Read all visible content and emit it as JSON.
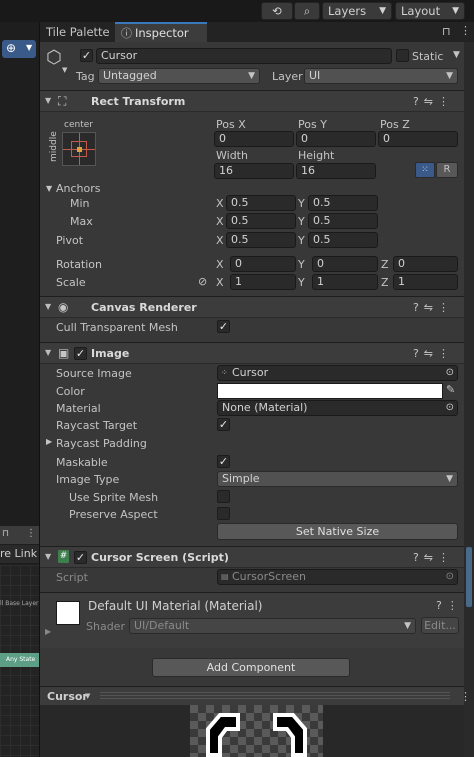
{
  "toolbar": {
    "layers": "Layers",
    "layout": "Layout",
    "history_icon": "history-icon",
    "search_icon": "search-icon"
  },
  "tabs": {
    "tile_palette": "Tile Palette",
    "inspector": "Inspector"
  },
  "object": {
    "name": "Cursor",
    "active": true,
    "static_label": "Static",
    "tag_label": "Tag",
    "tag": "Untagged",
    "layer_label": "Layer",
    "layer": "UI"
  },
  "rect_transform": {
    "title": "Rect Transform",
    "anchor_h": "center",
    "anchor_v": "middle",
    "pos_x_label": "Pos X",
    "pos_y_label": "Pos Y",
    "pos_z_label": "Pos Z",
    "pos_x": "0",
    "pos_y": "0",
    "pos_z": "0",
    "width_label": "Width",
    "height_label": "Height",
    "width": "16",
    "height": "16",
    "r_button": "R",
    "anchors_label": "Anchors",
    "min_label": "Min",
    "max_label": "Max",
    "min_x": "0.5",
    "min_y": "0.5",
    "max_x": "0.5",
    "max_y": "0.5",
    "pivot_label": "Pivot",
    "pivot_x": "0.5",
    "pivot_y": "0.5",
    "rotation_label": "Rotation",
    "rot_x": "0",
    "rot_y": "0",
    "rot_z": "0",
    "scale_label": "Scale",
    "scale_x": "1",
    "scale_y": "1",
    "scale_z": "1",
    "x": "X",
    "y": "Y",
    "z": "Z"
  },
  "canvas_renderer": {
    "title": "Canvas Renderer",
    "cull_label": "Cull Transparent Mesh",
    "cull": true
  },
  "image": {
    "title": "Image",
    "source_label": "Source Image",
    "source": "Cursor",
    "color_label": "Color",
    "color": "#ffffff",
    "material_label": "Material",
    "material": "None (Material)",
    "raycast_target_label": "Raycast Target",
    "raycast_target": true,
    "raycast_padding_label": "Raycast Padding",
    "maskable_label": "Maskable",
    "maskable": true,
    "image_type_label": "Image Type",
    "image_type": "Simple",
    "use_sprite_mesh_label": "Use Sprite Mesh",
    "preserve_aspect_label": "Preserve Aspect",
    "native_size_button": "Set Native Size"
  },
  "script": {
    "title": "Cursor Screen (Script)",
    "script_label": "Script",
    "script_value": "CursorScreen"
  },
  "material": {
    "title": "Default UI Material (Material)",
    "shader_label": "Shader",
    "shader": "UI/Default",
    "edit_button": "Edit..."
  },
  "add_component": "Add Component",
  "preview": {
    "title": "Cursor"
  },
  "left_panel": {
    "text1": "re Link",
    "text2": "ll Base Layer",
    "text3": "Any State"
  }
}
